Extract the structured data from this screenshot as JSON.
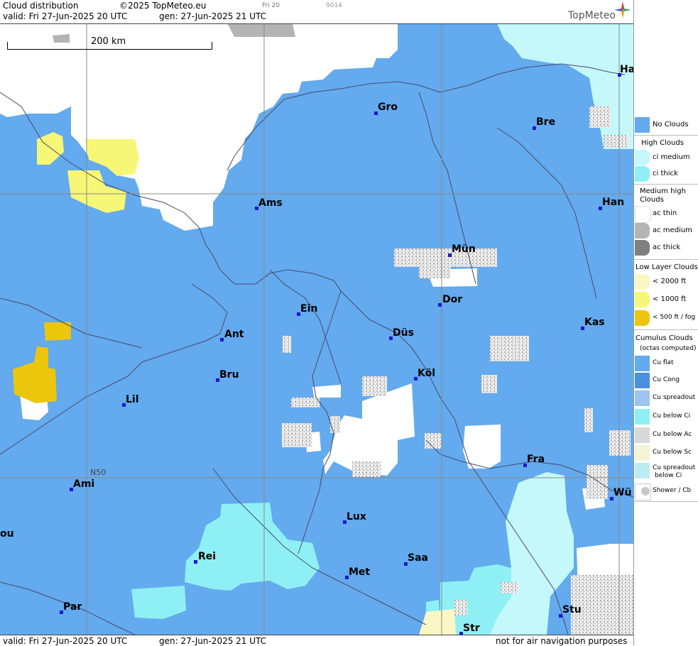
{
  "header": {
    "title": "Cloud distribution",
    "copyright": "©2025 TopMeteo.eu",
    "slot": "Fri 20",
    "code": "9014",
    "valid": "valid:  Fri  27-Jun-2025  20 UTC",
    "gen": "gen: 27-Jun-2025 21 UTC",
    "brand": "TopMeteo"
  },
  "footer": {
    "valid": "valid:  Fri  27-Jun-2025  20 UTC",
    "gen": "gen: 27-Jun-2025 21 UTC",
    "notice": "not for air navigation purposes"
  },
  "map": {
    "scale_label": "200 km",
    "latitude_label": "N50",
    "cities": [
      {
        "id": "ha",
        "label": "Ha"
      },
      {
        "id": "gro",
        "label": "Gro"
      },
      {
        "id": "bre",
        "label": "Bre"
      },
      {
        "id": "ams",
        "label": "Ams"
      },
      {
        "id": "han",
        "label": "Han"
      },
      {
        "id": "mun",
        "label": "Mün"
      },
      {
        "id": "dor",
        "label": "Dor"
      },
      {
        "id": "ein",
        "label": "Ein"
      },
      {
        "id": "kas",
        "label": "Kas"
      },
      {
        "id": "ant",
        "label": "Ant"
      },
      {
        "id": "dus",
        "label": "Düs"
      },
      {
        "id": "kol",
        "label": "Köl"
      },
      {
        "id": "bru",
        "label": "Bru"
      },
      {
        "id": "lil",
        "label": "Lil"
      },
      {
        "id": "fra",
        "label": "Fra"
      },
      {
        "id": "ami",
        "label": "Ami"
      },
      {
        "id": "wu",
        "label": "Wü"
      },
      {
        "id": "lux",
        "label": "Lux"
      },
      {
        "id": "ou",
        "label": "ou"
      },
      {
        "id": "rei",
        "label": "Rei"
      },
      {
        "id": "saa",
        "label": "Saa"
      },
      {
        "id": "met",
        "label": "Met"
      },
      {
        "id": "par",
        "label": "Par"
      },
      {
        "id": "stu",
        "label": "Stu"
      },
      {
        "id": "str",
        "label": "Str"
      }
    ]
  },
  "legend": {
    "no_clouds": "No Clouds",
    "high_heading": "High Clouds",
    "ci_medium": "ci medium",
    "ci_thick": "ci thick",
    "medium_heading": "Medium high Clouds",
    "ac_thin": "ac thin",
    "ac_medium": "ac medium",
    "ac_thick": "ac thick",
    "low_heading": "Low Layer Clouds",
    "low_2000": "< 2000 ft",
    "low_1000": "< 1000 ft",
    "low_500": "< 500 ft / fog",
    "cu_heading": "Cumulus Clouds",
    "cu_sub": "(octas computed)",
    "cu_flat": "Cu flat",
    "cu_cong": "Cu Cong",
    "cu_spread": "Cu spreadout",
    "cu_below_ci": "Cu below Ci",
    "cu_below_ac": "Cu below Ac",
    "cu_below_sc": "Cu below Sc",
    "cu_spread_ci_1": "Cu spreadout",
    "cu_spread_ci_2": "below Ci",
    "shower": "Shower / Cb"
  },
  "colors": {
    "no_clouds": "#63aaee",
    "ci_medium": "#c4f8fb",
    "ci_thick": "#8ef0f4",
    "ac_thin": "#ffffff",
    "ac_medium": "#b4b4b4",
    "ac_thick": "#7f7f7f",
    "low_2000": "#fbf7c4",
    "low_1000": "#f7f777",
    "low_500": "#ecc60c"
  }
}
